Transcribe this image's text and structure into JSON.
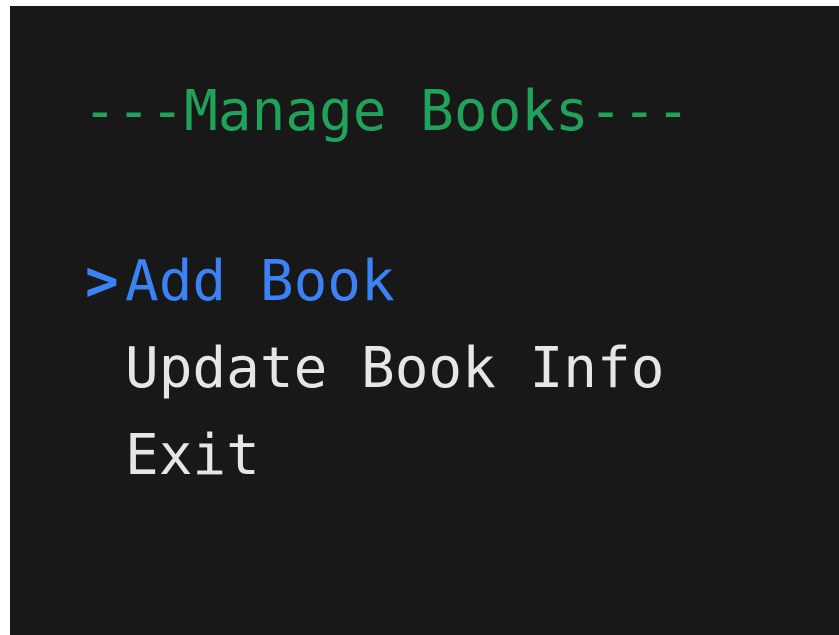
{
  "menu": {
    "title": "---Manage Books---",
    "cursor": ">",
    "items": [
      {
        "label": "Add Book",
        "selected": true
      },
      {
        "label": "Update Book Info",
        "selected": false
      },
      {
        "label": "Exit",
        "selected": false
      }
    ]
  },
  "colors": {
    "background": "#181818",
    "title": "#1fa35a",
    "selected": "#3b82f6",
    "text": "#e6e6e6"
  }
}
